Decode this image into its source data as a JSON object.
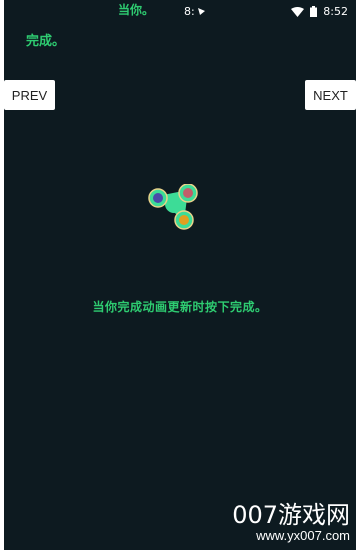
{
  "status_bar": {
    "top_text": "当你。",
    "center_text": "8:",
    "time": "8:52"
  },
  "header": {
    "label": "完成。"
  },
  "navigation": {
    "prev_label": "PREV",
    "next_label": "NEXT"
  },
  "spinner": {
    "icon": "fidget-spinner-icon",
    "body_color": "#3ddc97",
    "ring_color": "#e8d28a",
    "center_colors": [
      "#4a4aa8",
      "#c0606a",
      "#e0a020"
    ]
  },
  "main": {
    "caption": "当你完成动画更新时按下完成。"
  },
  "watermark": {
    "title": "007游戏网",
    "url": "www.yx007.com"
  },
  "colors": {
    "background": "#0d1a20",
    "accent_green": "#2ecc71"
  }
}
